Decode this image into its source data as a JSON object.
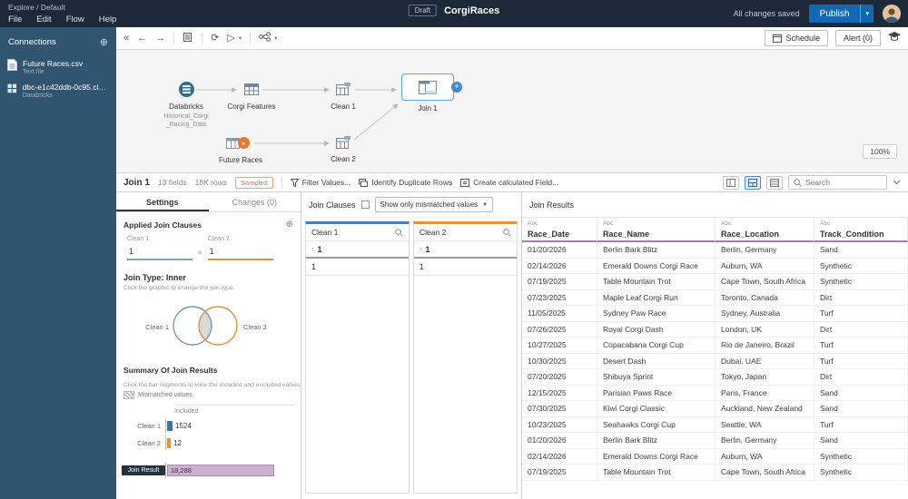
{
  "topbar": {
    "breadcrumb": "Explore  /  Default",
    "menus": [
      "File",
      "Edit",
      "Flow",
      "Help"
    ],
    "draft_badge": "Draft",
    "title": "CorgiRaces",
    "save_status": "All changes saved",
    "publish_label": "Publish"
  },
  "toolbar": {
    "schedule_label": "Schedule",
    "alert_label": "Alert (0)"
  },
  "connections": {
    "title": "Connections",
    "items": [
      {
        "name": "Future Races.csv",
        "type": "Text file"
      },
      {
        "name": "dbc-e1c42ddb-0c95.cloud...",
        "type": "Databricks"
      }
    ]
  },
  "flow": {
    "nodes": {
      "databricks": {
        "label": "Databricks",
        "sub1": "Historical_Corgi",
        "sub2": "_Racing_Data"
      },
      "corgi_features": {
        "label": "Corgi Features"
      },
      "clean1": {
        "label": "Clean 1"
      },
      "join1": {
        "label": "Join 1"
      },
      "future_races": {
        "label": "Future Races"
      },
      "clean2": {
        "label": "Clean 2"
      }
    },
    "zoom": "100%"
  },
  "statusbar": {
    "node_name": "Join 1",
    "field_count": "13 fields",
    "row_count": "18K rows",
    "sampled_badge": "Sampled",
    "actions": [
      "Filter Values...",
      "Identify Duplicate Rows",
      "Create calculated Field..."
    ],
    "search_placeholder": "Search"
  },
  "settings_panel": {
    "tab_settings": "Settings",
    "tab_changes": "Changes (0)",
    "section_title": "Applied Join Clauses",
    "clause": {
      "left_table": "Clean 1",
      "right_table": "Clean 2",
      "left_value": "1",
      "right_value": "1",
      "operator": "="
    },
    "join_type": "Join Type: Inner",
    "join_type_hint": "Click the graphic to change the join type.",
    "venn_left": "Clean 1",
    "venn_right": "Clean 2",
    "summary_title": "Summary Of Join Results",
    "summary_hint": "Click the bar segments to view the included and excluded values.",
    "legend_mismatched": "Mismatched values",
    "included_label": "Included",
    "bar_clean1_label": "Clean 1",
    "bar_clean1_value": "1524",
    "bar_clean2_label": "Clean 2",
    "bar_clean2_value": "12",
    "bar_join_label": "Join Result",
    "bar_join_value": "18,288"
  },
  "join_clauses_panel": {
    "title": "Join Clauses",
    "filter_label": "Show only mismatched values",
    "left": {
      "name": "Clean 1",
      "field": "1",
      "value": "1"
    },
    "right": {
      "name": "Clean 2",
      "field": "1",
      "value": "1"
    }
  },
  "join_results": {
    "title": "Join Results",
    "type_label": "Abc",
    "columns": [
      "Race_Date",
      "Race_Name",
      "Race_Location",
      "Track_Condition"
    ],
    "rows": [
      [
        "01/20/2026",
        "Berlin Bark Blitz",
        "Berlin, Germany",
        "Sand"
      ],
      [
        "02/14/2026",
        "Emerald Downs Corgi Race",
        "Auburn, WA",
        "Synthetic"
      ],
      [
        "07/19/2025",
        "Table Mountain Trot",
        "Cape Town, South Africa",
        "Synthetic"
      ],
      [
        "07/23/2025",
        "Maple Leaf Corgi Run",
        "Toronto, Canada",
        "Dirt"
      ],
      [
        "11/05/2025",
        "Sydney Paw Race",
        "Sydney, Australia",
        "Turf"
      ],
      [
        "07/26/2025",
        "Royal Corgi Dash",
        "London, UK",
        "Dirt"
      ],
      [
        "10/27/2025",
        "Copacabana Corgi Cup",
        "Rio de Janeiro, Brazil",
        "Turf"
      ],
      [
        "10/30/2025",
        "Desert Dash",
        "Dubai, UAE",
        "Turf"
      ],
      [
        "07/20/2025",
        "Shibuya Sprint",
        "Tokyo, Japan",
        "Dirt"
      ],
      [
        "12/15/2025",
        "Parisian Paws Race",
        "Paris, France",
        "Sand"
      ],
      [
        "07/30/2025",
        "Kiwi Corgi Classic",
        "Auckland, New Zealand",
        "Sand"
      ],
      [
        "10/23/2025",
        "Seahawks Corgi Cup",
        "Seattle, WA",
        "Turf"
      ],
      [
        "01/20/2026",
        "Berlin Bark Blitz",
        "Berlin, Germany",
        "Sand"
      ],
      [
        "02/14/2026",
        "Emerald Downs Corgi Race",
        "Auburn, WA",
        "Synthetic"
      ],
      [
        "07/19/2025",
        "Table Mountain Trot",
        "Cape Town, South Africa",
        "Synthetic"
      ]
    ]
  },
  "colors": {
    "topbar_bg": "#1b2939",
    "sidebar_bg": "#305571",
    "publish_blue": "#1268b3",
    "accent_blue": "#4f7db3",
    "accent_orange": "#e8913a",
    "results_purple": "#b077be",
    "join_bar_fill": "#cdb0cf",
    "sampled_orange": "#e8762d"
  }
}
